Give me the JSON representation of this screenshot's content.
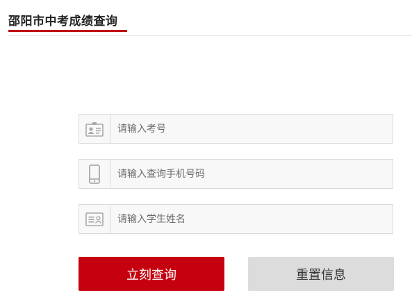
{
  "header": {
    "title": "邵阳市中考成绩查询"
  },
  "form": {
    "fields": [
      {
        "icon": "id-badge-icon",
        "placeholder": "请输入考号"
      },
      {
        "icon": "mobile-phone-icon",
        "placeholder": "请输入查询手机号码"
      },
      {
        "icon": "id-card-icon",
        "placeholder": "请输入学生姓名"
      }
    ]
  },
  "buttons": {
    "submit_label": "立刻查询",
    "reset_label": "重置信息"
  },
  "colors": {
    "accent": "#c5000f",
    "secondary_button": "#dcdcdc",
    "field_background": "#f8f8f8",
    "border": "#dadada"
  }
}
